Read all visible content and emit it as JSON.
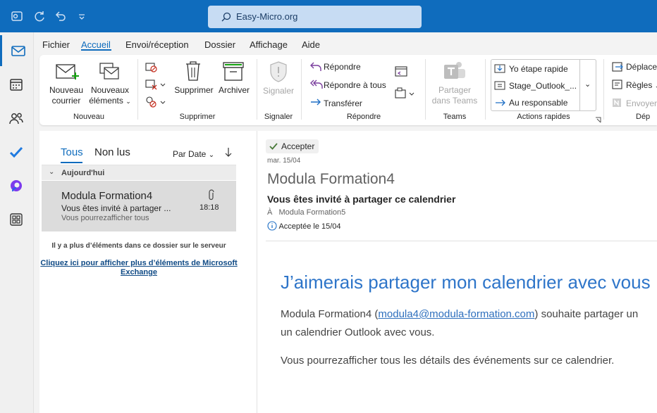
{
  "titlebar": {
    "search_placeholder": "Easy-Micro.org"
  },
  "menu": {
    "tabs": [
      "Fichier",
      "Accueil",
      "Envoi/réception",
      "Dossier",
      "Affichage",
      "Aide"
    ]
  },
  "ribbon": {
    "new_mail": [
      "Nouveau",
      "courrier"
    ],
    "new_items": [
      "Nouveaux",
      "éléments"
    ],
    "group_new": "Nouveau",
    "delete": "Supprimer",
    "archive": "Archiver",
    "group_delete": "Supprimer",
    "report": "Signaler",
    "group_report": "Signaler",
    "reply": "Répondre",
    "reply_all": "Répondre à tous",
    "forward": "Transférer",
    "group_reply": "Répondre",
    "share_teams": [
      "Partager",
      "dans Teams"
    ],
    "group_teams": "Teams",
    "quick_steps": [
      "Yo étape rapide",
      "Stage_Outlook_...",
      "Au responsable"
    ],
    "group_quick": "Actions rapides",
    "move": "Déplace",
    "rules": "Règles",
    "send": "Envoyer",
    "group_move": "Dép"
  },
  "list": {
    "tab_all": "Tous",
    "tab_unread": "Non lus",
    "sort": "Par Date",
    "group_today": "Aujourd'hui",
    "item": {
      "sender": "Modula Formation4",
      "subject": "Vous êtes invité à partager ...",
      "preview": "Vous pourrezafficher tous",
      "time": "18:18"
    },
    "server_note": "Il y a plus d’éléments dans ce dossier sur le serveur",
    "more_link": "Cliquez ici pour afficher plus d’éléments de Microsoft Exchange"
  },
  "reading": {
    "accept": "Accepter",
    "date": "mar. 15/04",
    "sender": "Modula Formation4",
    "subject": "Vous êtes invité à partager ce calendrier",
    "to_label": "À",
    "to": "Modula Formation5",
    "status": "Acceptée le 15/04",
    "heading": "J’aimerais partager mon calendrier avec vous",
    "body1_pre": "Modula Formation4 (",
    "body1_link": "modula4@modula-formation.com",
    "body1_post": ") souhaite partager un",
    "body2": "un calendrier Outlook avec vous.",
    "body3": "Vous pourrezafficher tous les détails des événements sur ce calendrier."
  },
  "colors": {
    "accent": "#0f6cbd",
    "heading": "#2e75c9"
  }
}
